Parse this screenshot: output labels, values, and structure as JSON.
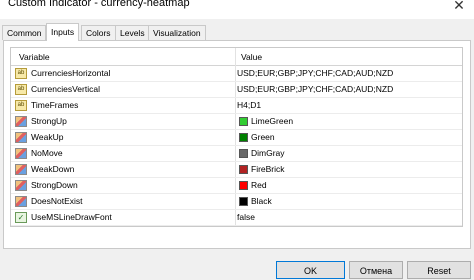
{
  "window": {
    "title": "Custom Indicator - currency-heatmap",
    "close_glyph": "✕"
  },
  "tabs": [
    {
      "label": "Common",
      "active": false
    },
    {
      "label": "Inputs",
      "active": true
    },
    {
      "label": "Colors",
      "active": false
    },
    {
      "label": "Levels",
      "active": false
    },
    {
      "label": "Visualization",
      "active": false
    }
  ],
  "grid": {
    "columns": {
      "variable": "Variable",
      "value": "Value"
    },
    "rows": [
      {
        "icon": "ab-text-icon",
        "badge": "ab",
        "name": "CurrenciesHorizontal",
        "value": "USD;EUR;GBP;JPY;CHF;CAD;AUD;NZD"
      },
      {
        "icon": "ab-text-icon",
        "badge": "ab",
        "name": "CurrenciesVertical",
        "value": "USD;EUR;GBP;JPY;CHF;CAD;AUD;NZD"
      },
      {
        "icon": "ab-text-icon",
        "badge": "ab",
        "name": "TimeFrames",
        "value": "H4;D1"
      },
      {
        "icon": "color-icon",
        "name": "StrongUp",
        "value": "LimeGreen",
        "swatch": "#32cd32"
      },
      {
        "icon": "color-icon",
        "name": "WeakUp",
        "value": "Green",
        "swatch": "#008000"
      },
      {
        "icon": "color-icon",
        "name": "NoMove",
        "value": "DimGray",
        "swatch": "#696969"
      },
      {
        "icon": "color-icon",
        "name": "WeakDown",
        "value": "FireBrick",
        "swatch": "#b22222"
      },
      {
        "icon": "color-icon",
        "name": "StrongDown",
        "value": "Red",
        "swatch": "#ff0000"
      },
      {
        "icon": "color-icon",
        "name": "DoesNotExist",
        "value": "Black",
        "swatch": "#000000"
      },
      {
        "icon": "bool-icon",
        "badge": "✓",
        "name": "UseMSLineDrawFont",
        "value": "false"
      }
    ]
  },
  "buttons": {
    "ok": "OK",
    "cancel": "Отмена",
    "reset": "Reset"
  }
}
